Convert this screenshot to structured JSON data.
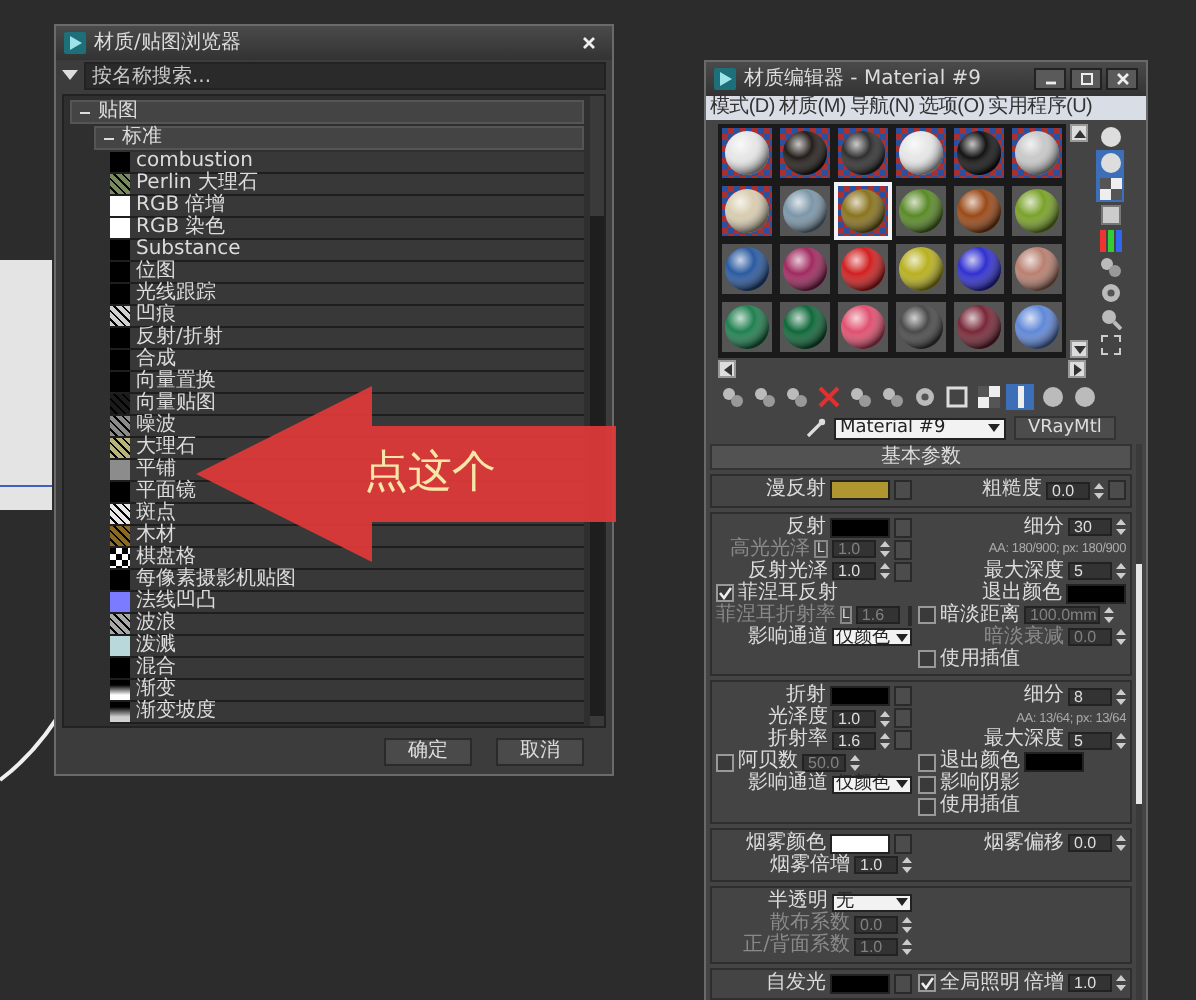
{
  "browser": {
    "title": "材质/贴图浏览器",
    "search": {
      "placeholder": "按名称搜索..."
    },
    "tree": [
      {
        "label": "贴图",
        "expanded": true,
        "children": [
          {
            "label": "标准",
            "expanded": true,
            "children": [
              {
                "label": "combustion",
                "kind": "solid",
                "color": "#000000"
              },
              {
                "label": "Perlin 大理石",
                "kind": "noise",
                "color": "#7a8a60"
              },
              {
                "label": "RGB 倍增",
                "kind": "solid",
                "color": "#ffffff"
              },
              {
                "label": "RGB 染色",
                "kind": "solid",
                "color": "#ffffff"
              },
              {
                "label": "Substance",
                "kind": "solid",
                "color": "#000000"
              },
              {
                "label": "位图",
                "kind": "solid",
                "color": "#000000"
              },
              {
                "label": "光线跟踪",
                "kind": "solid",
                "color": "#000000"
              },
              {
                "label": "凹痕",
                "kind": "noise",
                "color": "#d0d0d0"
              },
              {
                "label": "反射/折射",
                "kind": "solid",
                "color": "#000000"
              },
              {
                "label": "合成",
                "kind": "solid",
                "color": "#000000"
              },
              {
                "label": "向量置换",
                "kind": "solid",
                "color": "#000000"
              },
              {
                "label": "向量贴图",
                "kind": "noise",
                "color": "#1a1a1a"
              },
              {
                "label": "噪波",
                "kind": "noise",
                "color": "#8a8a8a"
              },
              {
                "label": "大理石",
                "kind": "noise",
                "color": "#b8b47a"
              },
              {
                "label": "平铺",
                "kind": "solid",
                "color": "#8c8c8c"
              },
              {
                "label": "平面镜",
                "kind": "solid",
                "color": "#000000"
              },
              {
                "label": "斑点",
                "kind": "noise",
                "color": "#e8e8e8"
              },
              {
                "label": "木材",
                "kind": "noise",
                "color": "#8a6a20"
              },
              {
                "label": "棋盘格",
                "kind": "checker",
                "color": "#ffffff"
              },
              {
                "label": "每像素摄影机贴图",
                "kind": "solid",
                "color": "#000000"
              },
              {
                "label": "法线凹凸",
                "kind": "solid",
                "color": "#7b7bff"
              },
              {
                "label": "波浪",
                "kind": "noise",
                "color": "#a8a8a8"
              },
              {
                "label": "泼溅",
                "kind": "solid",
                "color": "#b8d8dc"
              },
              {
                "label": "混合",
                "kind": "solid",
                "color": "#000000"
              },
              {
                "label": "渐变",
                "kind": "gradient",
                "color": "#ffffff"
              },
              {
                "label": "渐变坡度",
                "kind": "gradient",
                "color": "#d0d0d0"
              }
            ]
          }
        ]
      }
    ],
    "buttons": [
      "确定",
      "取消"
    ]
  },
  "callout": {
    "text": "点这个"
  },
  "editor": {
    "title": "材质编辑器 - Material #9",
    "menu": [
      "模式(D)",
      "材质(M)",
      "导航(N)",
      "选项(O)",
      "实用程序(U)"
    ],
    "slots": [
      {
        "color": "#e6e6e6",
        "selected": false,
        "backdrop": true
      },
      {
        "color": "#241e1a",
        "selected": false,
        "backdrop": true
      },
      {
        "color": "#303030",
        "selected": false,
        "backdrop": true
      },
      {
        "color": "#e6e6e6",
        "selected": false,
        "backdrop": true
      },
      {
        "color": "#141414",
        "selected": false,
        "backdrop": true
      },
      {
        "color": "#c8c8c8",
        "selected": false,
        "backdrop": true
      },
      {
        "color": "#d8ccb0",
        "selected": false,
        "backdrop": true
      },
      {
        "color": "#7c96a8",
        "selected": false,
        "backdrop": false
      },
      {
        "color": "#8a7420",
        "selected": true,
        "backdrop": true
      },
      {
        "color": "#5a8a28",
        "selected": false,
        "backdrop": false
      },
      {
        "color": "#9a4a18",
        "selected": false,
        "backdrop": false
      },
      {
        "color": "#7aa22a",
        "selected": false,
        "backdrop": false
      },
      {
        "color": "#2a5aa0",
        "selected": false,
        "backdrop": false
      },
      {
        "color": "#a02a60",
        "selected": false,
        "backdrop": false
      },
      {
        "color": "#d02020",
        "selected": false,
        "backdrop": false
      },
      {
        "color": "#b8b020",
        "selected": false,
        "backdrop": false
      },
      {
        "color": "#3030d0",
        "selected": false,
        "backdrop": false
      },
      {
        "color": "#b88070",
        "selected": false,
        "backdrop": false
      },
      {
        "color": "#208050",
        "selected": false,
        "backdrop": false
      },
      {
        "color": "#10683a",
        "selected": false,
        "backdrop": false
      },
      {
        "color": "#e05070",
        "selected": false,
        "backdrop": false
      },
      {
        "color": "#4a4a4a",
        "selected": false,
        "backdrop": false
      },
      {
        "color": "#782838",
        "selected": false,
        "backdrop": false
      },
      {
        "color": "#6088d8",
        "selected": false,
        "backdrop": false
      }
    ],
    "side_tools": [
      {
        "kind": "sphere",
        "on": false
      },
      {
        "kind": "sphere",
        "on": true
      },
      {
        "kind": "checker",
        "on": true
      },
      {
        "kind": "square",
        "on": false
      },
      {
        "kind": "bars",
        "on": false
      },
      {
        "kind": "spheres",
        "on": false
      },
      {
        "kind": "gear",
        "on": false
      },
      {
        "kind": "magnifier",
        "on": false
      },
      {
        "kind": "corners",
        "on": false
      }
    ],
    "tools": [
      {
        "kind": "spheres",
        "on": false
      },
      {
        "kind": "spheres",
        "on": false
      },
      {
        "kind": "spheres",
        "on": false
      },
      {
        "kind": "cross",
        "on": false
      },
      {
        "kind": "spheres",
        "on": false
      },
      {
        "kind": "spheres",
        "on": false
      },
      {
        "kind": "gear",
        "on": false
      },
      {
        "kind": "square",
        "on": false
      },
      {
        "kind": "checker",
        "on": false
      },
      {
        "kind": "bar",
        "on": true
      },
      {
        "kind": "sphere",
        "on": false
      },
      {
        "kind": "sphere",
        "on": false
      }
    ],
    "material_name": "Material #9",
    "material_type": "VRayMtl",
    "rollout": {
      "title": "基本参数",
      "groups": [
        {
          "rows": [
            {
              "left": [
                {
                  "kind": "label",
                  "text": "漫反射"
                },
                {
                  "kind": "swatch",
                  "color": "#b0962e",
                  "map": true
                }
              ],
              "right": [
                {
                  "kind": "label",
                  "text": "粗糙度"
                },
                {
                  "kind": "spinner",
                  "value": "0.0",
                  "map": true
                }
              ]
            }
          ]
        },
        {
          "rows": [
            {
              "left": [
                {
                  "kind": "label",
                  "text": "反射"
                },
                {
                  "kind": "swatch",
                  "color": "#000000",
                  "map": true
                }
              ],
              "right": [
                {
                  "kind": "label",
                  "text": "细分"
                },
                {
                  "kind": "spinner",
                  "value": "30"
                }
              ]
            },
            {
              "left": [
                {
                  "kind": "label",
                  "text": "高光光泽",
                  "disabled": true
                },
                {
                  "kind": "lock",
                  "text": "L"
                },
                {
                  "kind": "spinner",
                  "value": "1.0",
                  "disabled": true,
                  "map": true
                }
              ],
              "right": [
                {
                  "kind": "note",
                  "text": "AA: 180/900; px: 180/900"
                }
              ]
            },
            {
              "left": [
                {
                  "kind": "label",
                  "text": "反射光泽"
                },
                {
                  "kind": "spinner",
                  "value": "1.0",
                  "map": true
                }
              ],
              "right": [
                {
                  "kind": "label",
                  "text": "最大深度"
                },
                {
                  "kind": "spinner",
                  "value": "5"
                }
              ]
            },
            {
              "left": [
                {
                  "kind": "checkbox",
                  "label": "菲涅耳反射",
                  "checked": true
                }
              ],
              "right": [
                {
                  "kind": "label",
                  "text": "退出颜色"
                },
                {
                  "kind": "swatch",
                  "color": "#000000"
                }
              ]
            },
            {
              "left": [
                {
                  "kind": "label",
                  "text": "菲涅耳折射率",
                  "disabled": true
                },
                {
                  "kind": "lock",
                  "text": "L"
                },
                {
                  "kind": "spinner",
                  "value": "1.6",
                  "disabled": true,
                  "map": true
                }
              ],
              "right": [
                {
                  "kind": "checkbox",
                  "label": "暗淡距离",
                  "checked": false
                },
                {
                  "kind": "spinner",
                  "value": "100.0mm",
                  "disabled": true
                }
              ]
            },
            {
              "left": [
                {
                  "kind": "label",
                  "text": "影响通道"
                },
                {
                  "kind": "dropdown",
                  "value": "仅颜色"
                }
              ],
              "right": [
                {
                  "kind": "label",
                  "text": "暗淡衰减",
                  "disabled": true
                },
                {
                  "kind": "spinner",
                  "value": "0.0",
                  "disabled": true
                }
              ]
            },
            {
              "left": [],
              "right": [
                {
                  "kind": "checkbox",
                  "label": "使用插值",
                  "checked": false
                }
              ]
            }
          ]
        },
        {
          "rows": [
            {
              "left": [
                {
                  "kind": "label",
                  "text": "折射"
                },
                {
                  "kind": "swatch",
                  "color": "#000000",
                  "map": true
                }
              ],
              "right": [
                {
                  "kind": "label",
                  "text": "细分"
                },
                {
                  "kind": "spinner",
                  "value": "8"
                }
              ]
            },
            {
              "left": [
                {
                  "kind": "label",
                  "text": "光泽度"
                },
                {
                  "kind": "spinner",
                  "value": "1.0",
                  "map": true
                }
              ],
              "right": [
                {
                  "kind": "note",
                  "text": "AA: 13/64; px: 13/64"
                }
              ]
            },
            {
              "left": [
                {
                  "kind": "label",
                  "text": "折射率"
                },
                {
                  "kind": "spinner",
                  "value": "1.6",
                  "map": true
                }
              ],
              "right": [
                {
                  "kind": "label",
                  "text": "最大深度"
                },
                {
                  "kind": "spinner",
                  "value": "5"
                }
              ]
            },
            {
              "left": [
                {
                  "kind": "checkbox",
                  "label": "阿贝数",
                  "checked": false
                },
                {
                  "kind": "spinner",
                  "value": "50.0",
                  "disabled": true
                }
              ],
              "right": [
                {
                  "kind": "checkbox",
                  "label": "退出颜色",
                  "checked": false
                },
                {
                  "kind": "swatch",
                  "color": "#000000"
                }
              ]
            },
            {
              "left": [
                {
                  "kind": "label",
                  "text": "影响通道"
                },
                {
                  "kind": "dropdown",
                  "value": "仅颜色"
                }
              ],
              "right": [
                {
                  "kind": "checkbox",
                  "label": "影响阴影",
                  "checked": false
                }
              ]
            },
            {
              "left": [],
              "right": [
                {
                  "kind": "checkbox",
                  "label": "使用插值",
                  "checked": false
                }
              ]
            }
          ]
        },
        {
          "rows": [
            {
              "left": [
                {
                  "kind": "label",
                  "text": "烟雾颜色"
                },
                {
                  "kind": "swatch",
                  "color": "#ffffff",
                  "map": true
                }
              ],
              "right": [
                {
                  "kind": "label",
                  "text": "烟雾偏移"
                },
                {
                  "kind": "spinner",
                  "value": "0.0"
                }
              ]
            },
            {
              "left": [
                {
                  "kind": "label",
                  "text": "烟雾倍增"
                },
                {
                  "kind": "spinner",
                  "value": "1.0"
                }
              ],
              "right": []
            }
          ]
        },
        {
          "rows": [
            {
              "left": [
                {
                  "kind": "label",
                  "text": "半透明"
                },
                {
                  "kind": "dropdown",
                  "value": "无"
                }
              ],
              "right": []
            },
            {
              "left": [
                {
                  "kind": "label",
                  "text": "散布系数",
                  "disabled": true
                },
                {
                  "kind": "spinner",
                  "value": "0.0",
                  "disabled": true
                }
              ],
              "right": []
            },
            {
              "left": [
                {
                  "kind": "label",
                  "text": "正/背面系数",
                  "disabled": true
                },
                {
                  "kind": "spinner",
                  "value": "1.0",
                  "disabled": true
                }
              ],
              "right": []
            }
          ]
        },
        {
          "rows": [
            {
              "left": [
                {
                  "kind": "label",
                  "text": "自发光"
                },
                {
                  "kind": "swatch",
                  "color": "#000000",
                  "map": true
                }
              ],
              "right": [
                {
                  "kind": "checkbox",
                  "label": "全局照明",
                  "checked": true
                },
                {
                  "kind": "label",
                  "text": "倍增"
                },
                {
                  "kind": "spinner",
                  "value": "1.0"
                }
              ]
            }
          ]
        }
      ]
    }
  }
}
